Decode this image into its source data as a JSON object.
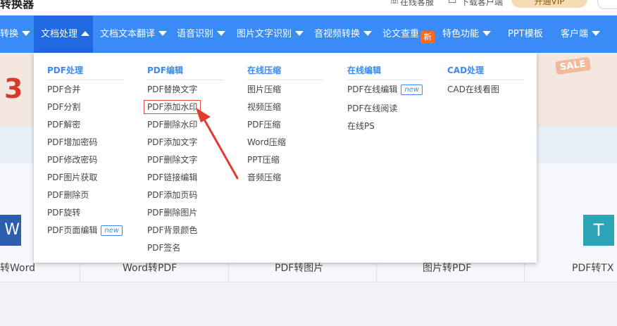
{
  "topbar": {
    "logo_text": "转换器",
    "link_a": "在线客服",
    "link_b": "下载客户端",
    "vip_label": "开通VIP"
  },
  "nav": {
    "items": [
      {
        "label": "转换",
        "active": false,
        "caret": "down"
      },
      {
        "label": "文档处理",
        "active": true,
        "caret": "up"
      },
      {
        "label": "文档文本翻译",
        "active": false,
        "caret": "down"
      },
      {
        "label": "语音识别",
        "active": false,
        "caret": "down"
      },
      {
        "label": "图片文字识别",
        "active": false,
        "caret": "down"
      },
      {
        "label": "音视频转换",
        "active": false,
        "caret": "down"
      },
      {
        "label": "论文查重",
        "active": false,
        "caret": "down"
      },
      {
        "label": "特色功能",
        "active": false,
        "caret": "down"
      },
      {
        "label": "PPT模板",
        "active": false,
        "caret": "none"
      },
      {
        "label": "客户端",
        "active": false,
        "caret": "down"
      }
    ],
    "new_badge": "新"
  },
  "hero": {
    "number_fragment": "3",
    "sale_tag": "SALE"
  },
  "tools": {
    "icon_w": "W",
    "icon_t": "T",
    "labels": [
      "转Word",
      "Word转PDF",
      "PDF转图片",
      "图片转PDF",
      "PDF转TX"
    ]
  },
  "dropdown": {
    "columns": [
      {
        "heading": "PDF处理",
        "items": [
          "PDF合并",
          "PDF分割",
          "PDF解密",
          "PDF增加密码",
          "PDF修改密码",
          "PDF图片获取",
          "PDF删除页",
          "PDF旋转",
          "PDF页面编辑"
        ],
        "new_tag_index": 8
      },
      {
        "heading": "PDF编辑",
        "items": [
          "PDF替换文字",
          "PDF添加水印",
          "PDF删除水印",
          "PDF添加文字",
          "PDF删除文字",
          "PDF链接编辑",
          "PDF添加页码",
          "PDF删除图片",
          "PDF背景颜色",
          "PDF签名"
        ],
        "highlighted_index": 1
      },
      {
        "heading": "在线压缩",
        "items": [
          "图片压缩",
          "视频压缩",
          "PDF压缩",
          "Word压缩",
          "PPT压缩",
          "音频压缩"
        ]
      },
      {
        "heading": "在线编辑",
        "items": [
          "PDF在线编辑",
          "PDF在线阅读",
          "在线PS"
        ],
        "new_tag_index": 0
      },
      {
        "heading": "CAD处理",
        "items": [
          "CAD在线看图"
        ]
      }
    ],
    "new_tag_label": "new"
  },
  "colors": {
    "nav_bg": "#3a8bf6",
    "nav_active": "#2168e3",
    "heading": "#3a8bf6",
    "highlight": "#e84a3c"
  }
}
